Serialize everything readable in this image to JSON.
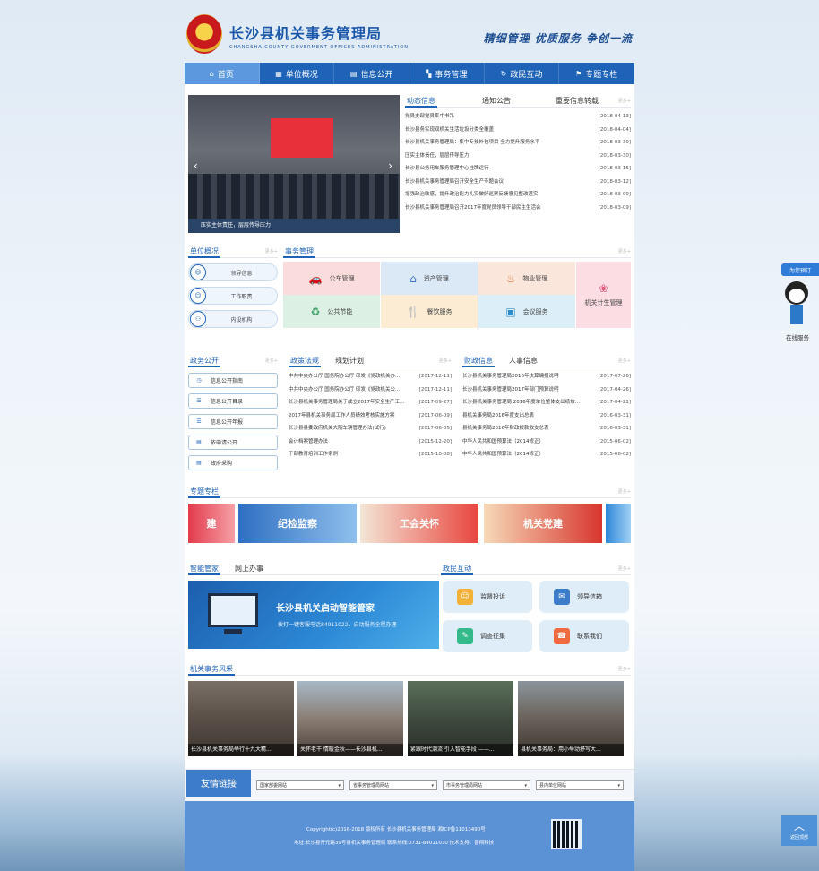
{
  "header": {
    "title": "长沙县机关事务管理局",
    "subtitle": "CHANGSHA COUNTY GOVERMENT OFFICES ADMINISTRATION",
    "slogan": "精细管理 优质服务 争创一流"
  },
  "nav": [
    {
      "label": "首页",
      "icon": "home-icon"
    },
    {
      "label": "单位概况",
      "icon": "building-icon"
    },
    {
      "label": "信息公开",
      "icon": "document-icon"
    },
    {
      "label": "事务管理",
      "icon": "grid-icon"
    },
    {
      "label": "政民互动",
      "icon": "refresh-icon"
    },
    {
      "label": "专题专栏",
      "icon": "flag-icon"
    }
  ],
  "slideshow": {
    "caption": "压实主体责任，层层传导压力"
  },
  "news": {
    "tabs": [
      "动态信息",
      "通知公告",
      "重要信息转载"
    ],
    "more": "更多+",
    "items": [
      {
        "title": "党员支部党员集中书吊",
        "date": "[2018-04-13]"
      },
      {
        "title": "长沙县务实现双机关生活垃圾分类全覆盖",
        "date": "[2018-04-04]"
      },
      {
        "title": "长沙县机关事务管理局：集中专技外包项目 全力提升服务水平",
        "date": "[2018-03-30]"
      },
      {
        "title": "压实主体责任，层层传导压力",
        "date": "[2018-03-30]"
      },
      {
        "title": "长沙县公务用车服务管理中心挂牌运行",
        "date": "[2018-03-15]"
      },
      {
        "title": "长沙县机关事务管理局召开安全生产专题会议",
        "date": "[2018-03-12]"
      },
      {
        "title": "增强政治敏感，提升政治能力扎实做好巡察反馈意见整改落实",
        "date": "[2018-03-09]"
      },
      {
        "title": "长沙县机关事务管理局召开2017年度党员领导干部民主生活会",
        "date": "[2018-03-09]"
      }
    ]
  },
  "unit": {
    "title": "单位概况",
    "more": "更多+",
    "items": [
      "领导信息",
      "工作职责",
      "内设机构"
    ]
  },
  "services": {
    "title": "事务管理",
    "more": "更多+",
    "items": [
      "公车管理",
      "资产管理",
      "物业管理",
      "机关计生管理",
      "公共节能",
      "餐饮服务",
      "会议服务"
    ]
  },
  "gov": {
    "title": "政务公开",
    "more": "更多+",
    "items": [
      "信息公开指南",
      "信息公开目录",
      "信息公开年报",
      "依申请公开",
      "政府采购"
    ]
  },
  "policy": {
    "tabs": [
      "政策法规",
      "规划计划"
    ],
    "more": "更多+",
    "items": [
      {
        "title": "中共中央办公厅 国务院办公厅 印发《党政机关办...",
        "date": "[2017-12-11]"
      },
      {
        "title": "中共中央办公厅 国务院办公厅 印发《党政机关公...",
        "date": "[2017-12-11]"
      },
      {
        "title": "长沙县机关事务管理局关于成立2017年安全生产工...",
        "date": "[2017-09-27]"
      },
      {
        "title": "2017年县机关事务局工作人员绩效考核实施方案",
        "date": "[2017-06-09]"
      },
      {
        "title": "长沙县县委政府机关大院车辆管理办法(试行)",
        "date": "[2017-06-05]"
      },
      {
        "title": "会计档案管理办法",
        "date": "[2015-12-20]"
      },
      {
        "title": "干部教育培训工作条例",
        "date": "[2015-10-08]"
      }
    ]
  },
  "finance": {
    "tabs": [
      "财政信息",
      "人事信息"
    ],
    "more": "更多+",
    "items": [
      {
        "title": "长沙县机关事务管理局2016年决算编报说明",
        "date": "[2017-07-26]"
      },
      {
        "title": "长沙县机关事务管理局2017年部门预算说明",
        "date": "[2017-04-26]"
      },
      {
        "title": "长沙县机关事务管理局 2016年度单位整体支出绩效...",
        "date": "[2017-04-21]"
      },
      {
        "title": "县机关事务局2016年度支出总表",
        "date": "[2016-03-31]"
      },
      {
        "title": "县机关事务局2016年财政拨款收支总表",
        "date": "[2016-03-31]"
      },
      {
        "title": "中华人民共和国预算法（2014修正）",
        "date": "[2015-06-02]"
      },
      {
        "title": "中华人民共和国预算法（2014修正）",
        "date": "[2015-06-02]"
      }
    ]
  },
  "special": {
    "title": "专题专栏",
    "more": "更多+",
    "banners": [
      "建",
      "纪检监察",
      "工会关怀",
      "机关党建"
    ]
  },
  "smart": {
    "tabs": [
      "智能管家",
      "网上办事"
    ],
    "headline": "长沙县机关启动智能管家",
    "sub": "拨打一键客服电话84011022，启动服务全程办理"
  },
  "interaction": {
    "title": "政民互动",
    "more": "更多+",
    "items": [
      "监督投诉",
      "领导信箱",
      "调查征集",
      "联系我们"
    ]
  },
  "photos": {
    "title": "机关事务风采",
    "more": "更多+",
    "items": [
      "长沙县机关事务局举行十九大精...",
      "关怀老干 情暖金秋——长沙县机...",
      "紧跟时代潮流 引入智能手段 ——...",
      "县机关事务局：用小举动抒写大..."
    ]
  },
  "links": {
    "title": "友情链接",
    "selects": [
      "国家部委网站",
      "省事务管理局网站",
      "市事务管理局网站",
      "县内单位网站"
    ]
  },
  "footer": {
    "line1": "Copyright(c)2016-2018 版权所有 长沙县机关事务管理局 湘ICP备11013490号",
    "line2": "地址:长沙县开元路39号县机关事务管理局 联系热线:0731-84011030 技术支持：普翔科技"
  },
  "float": {
    "consult": "为您预订",
    "online": "在线服务",
    "back_top": "返回顶部"
  }
}
